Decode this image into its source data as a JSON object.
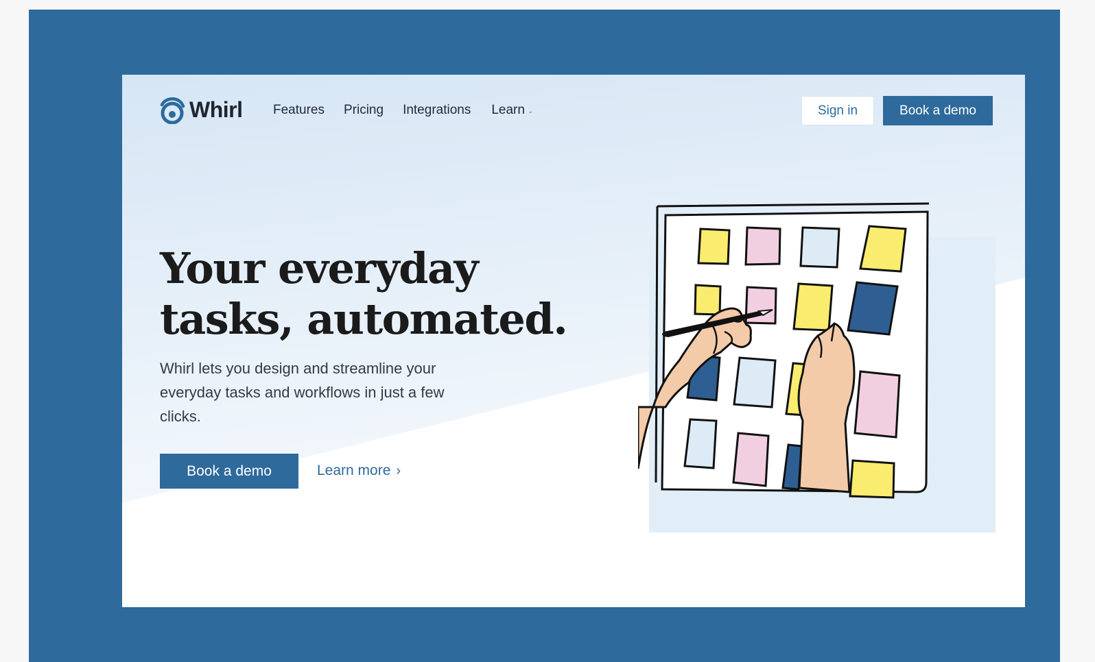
{
  "brand": {
    "name": "Whirl",
    "logo_icon": "whirl-spiral-icon"
  },
  "nav": {
    "links": [
      {
        "label": "Features"
      },
      {
        "label": "Pricing"
      },
      {
        "label": "Integrations"
      },
      {
        "label": "Learn",
        "has_dropdown": true
      }
    ],
    "signin_label": "Sign in",
    "demo_label": "Book a demo"
  },
  "hero": {
    "headline_line1": "Your everyday",
    "headline_line2": "tasks, automated.",
    "subtext": "Whirl lets you design and streamline your everyday tasks and workflows in just a few clicks.",
    "primary_cta": "Book a demo",
    "secondary_cta": "Learn more",
    "secondary_cta_icon": "chevron-right-icon"
  },
  "illustration": {
    "subject": "hands-placing-sticky-notes-on-board",
    "icon": "sticky-notes-board-illustration"
  },
  "colors": {
    "brand_blue": "#2e6a9b",
    "hero_gradient_top": "#d6e6f5",
    "note_yellow": "#f9ec6f",
    "note_pink": "#f2cfe0",
    "note_light_blue": "#dcebf6",
    "note_dark_blue": "#2f5e92",
    "skin": "#f4cba8"
  }
}
